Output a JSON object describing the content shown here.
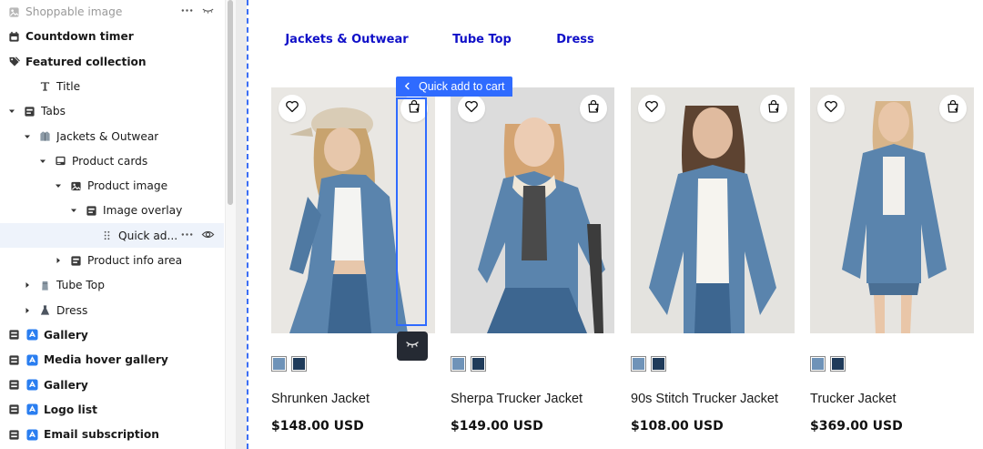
{
  "sidebar": {
    "items": [
      {
        "label": "Shoppable image",
        "icon": "image-block-icon",
        "depth": 0,
        "chevron": "none",
        "state": "dim",
        "actions": [
          "more",
          "eye-hidden"
        ]
      },
      {
        "label": "Countdown timer",
        "icon": "calendar-timer-icon",
        "depth": 0,
        "chevron": "none",
        "state": "bold"
      },
      {
        "label": "Featured collection",
        "icon": "tag-icon",
        "depth": 0,
        "chevron": "none",
        "state": "bold"
      },
      {
        "label": "Title",
        "icon": "text-t-icon",
        "depth": 1,
        "chevron": "none",
        "state": "normal"
      },
      {
        "label": "Tabs",
        "icon": "section-block-icon",
        "depth": 0,
        "chevron": "down",
        "state": "normal"
      },
      {
        "label": "Jackets & Outwear",
        "icon": "jacket-icon",
        "depth": 1,
        "chevron": "down",
        "state": "normal"
      },
      {
        "label": "Product cards",
        "icon": "product-card-icon",
        "depth": 2,
        "chevron": "down",
        "state": "normal"
      },
      {
        "label": "Product image",
        "icon": "image-icon",
        "depth": 3,
        "chevron": "down",
        "state": "normal"
      },
      {
        "label": "Image overlay",
        "icon": "section-block-icon",
        "depth": 4,
        "chevron": "down",
        "state": "normal"
      },
      {
        "label": "Quick ad...",
        "icon": "drag-handle-icon",
        "depth": 5,
        "chevron": "none",
        "state": "selected",
        "actions": [
          "more",
          "eye"
        ]
      },
      {
        "label": "Product info area",
        "icon": "section-block-icon",
        "depth": 3,
        "chevron": "right",
        "state": "normal"
      },
      {
        "label": "Tube Top",
        "icon": "tube-top-icon",
        "depth": 1,
        "chevron": "right",
        "state": "normal"
      },
      {
        "label": "Dress",
        "icon": "dress-icon",
        "depth": 1,
        "chevron": "right",
        "state": "normal"
      },
      {
        "label": "Gallery",
        "icon": "app-block-icon",
        "depth": 0,
        "chevron": "none",
        "state": "bold",
        "badge": true
      },
      {
        "label": "Media hover gallery",
        "icon": "app-block-icon",
        "depth": 0,
        "chevron": "none",
        "state": "bold",
        "badge": true
      },
      {
        "label": "Gallery",
        "icon": "app-block-icon",
        "depth": 0,
        "chevron": "none",
        "state": "bold",
        "badge": true
      },
      {
        "label": "Logo list",
        "icon": "app-block-icon",
        "depth": 0,
        "chevron": "none",
        "state": "bold",
        "badge": true
      },
      {
        "label": "Email subscription",
        "icon": "app-block-icon",
        "depth": 0,
        "chevron": "none",
        "state": "bold",
        "badge": true
      }
    ]
  },
  "tabs": [
    {
      "label": "Jackets & Outwear",
      "active": true
    },
    {
      "label": "Tube Top",
      "active": false
    },
    {
      "label": "Dress",
      "active": false
    }
  ],
  "selection": {
    "label": "Quick add to cart",
    "back_icon": "chevron-left-icon",
    "hide_icon": "eye-closed-icon"
  },
  "products": [
    {
      "name": "Shrunken Jacket",
      "price": "$148.00 USD",
      "swatches": [
        "#6f93b8",
        "#1f3b5a"
      ]
    },
    {
      "name": "Sherpa Trucker Jacket",
      "price": "$149.00 USD",
      "swatches": [
        "#6f93b8",
        "#1f3b5a"
      ]
    },
    {
      "name": "90s Stitch Trucker Jacket",
      "price": "$108.00 USD",
      "swatches": [
        "#6f93b8",
        "#1f3b5a"
      ]
    },
    {
      "name": "Trucker Jacket",
      "price": "$369.00 USD",
      "swatches": [
        "#6f93b8",
        "#1f3b5a"
      ]
    }
  ],
  "colors": {
    "accent": "#0f0ff0",
    "selection": "#2f6bff",
    "denim": "#5a84ad",
    "denim_dark": "#3d6690",
    "tab_inactive": "#1010c8"
  }
}
